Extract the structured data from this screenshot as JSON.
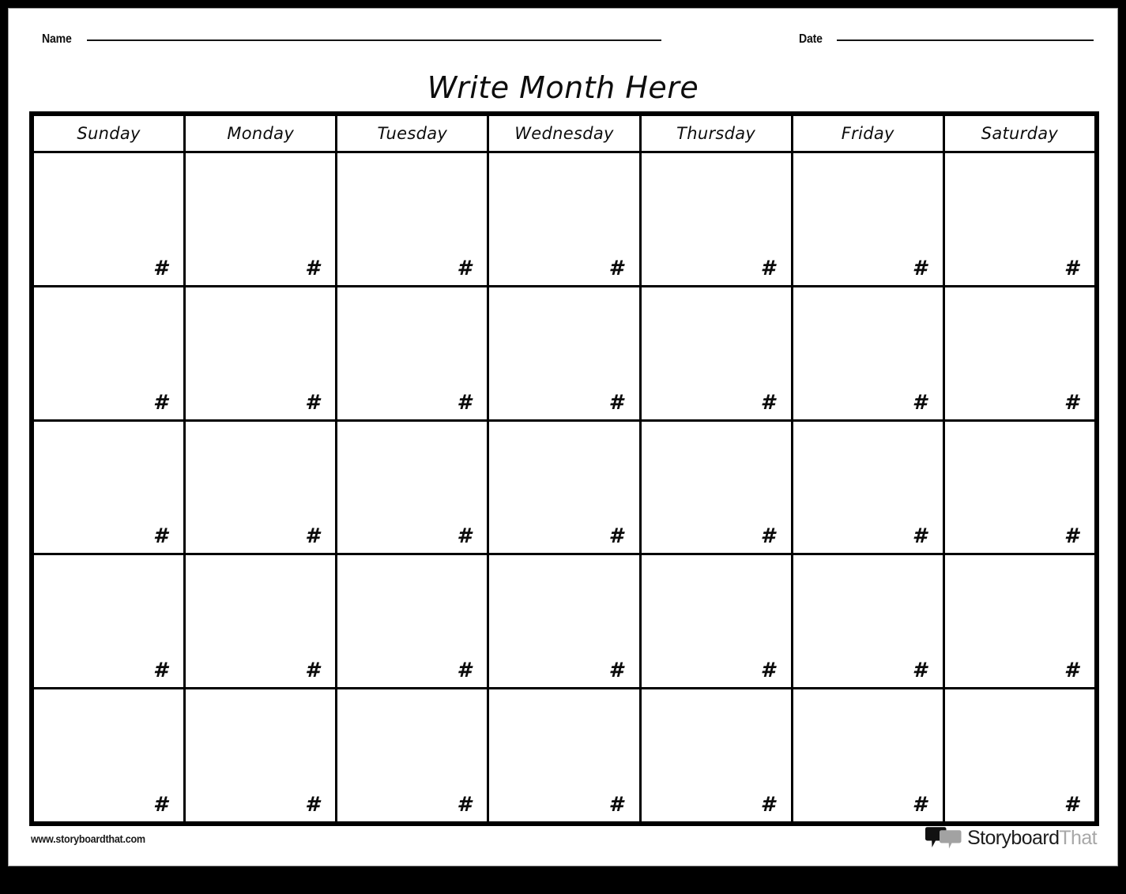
{
  "page": {
    "frame_color": "#000000",
    "sheet_color": "#ffffff"
  },
  "header": {
    "name_label": "Name",
    "date_label": "Date"
  },
  "title": "Write Month Here",
  "calendar": {
    "weekday_headers": [
      "Sunday",
      "Monday",
      "Tuesday",
      "Wednesday",
      "Thursday",
      "Friday",
      "Saturday"
    ],
    "day_placeholder": "#",
    "rows": 5,
    "columns": 7,
    "cells": [
      [
        "#",
        "#",
        "#",
        "#",
        "#",
        "#",
        "#"
      ],
      [
        "#",
        "#",
        "#",
        "#",
        "#",
        "#",
        "#"
      ],
      [
        "#",
        "#",
        "#",
        "#",
        "#",
        "#",
        "#"
      ],
      [
        "#",
        "#",
        "#",
        "#",
        "#",
        "#",
        "#"
      ],
      [
        "#",
        "#",
        "#",
        "#",
        "#",
        "#",
        "#"
      ]
    ]
  },
  "footer": {
    "url": "www.storyboardthat.com",
    "logo": {
      "icon": "speech-bubbles-icon",
      "text_dark": "Storyboard",
      "text_light": "That",
      "dark_color": "#1c1c1c",
      "light_color": "#a8a8a8"
    }
  }
}
